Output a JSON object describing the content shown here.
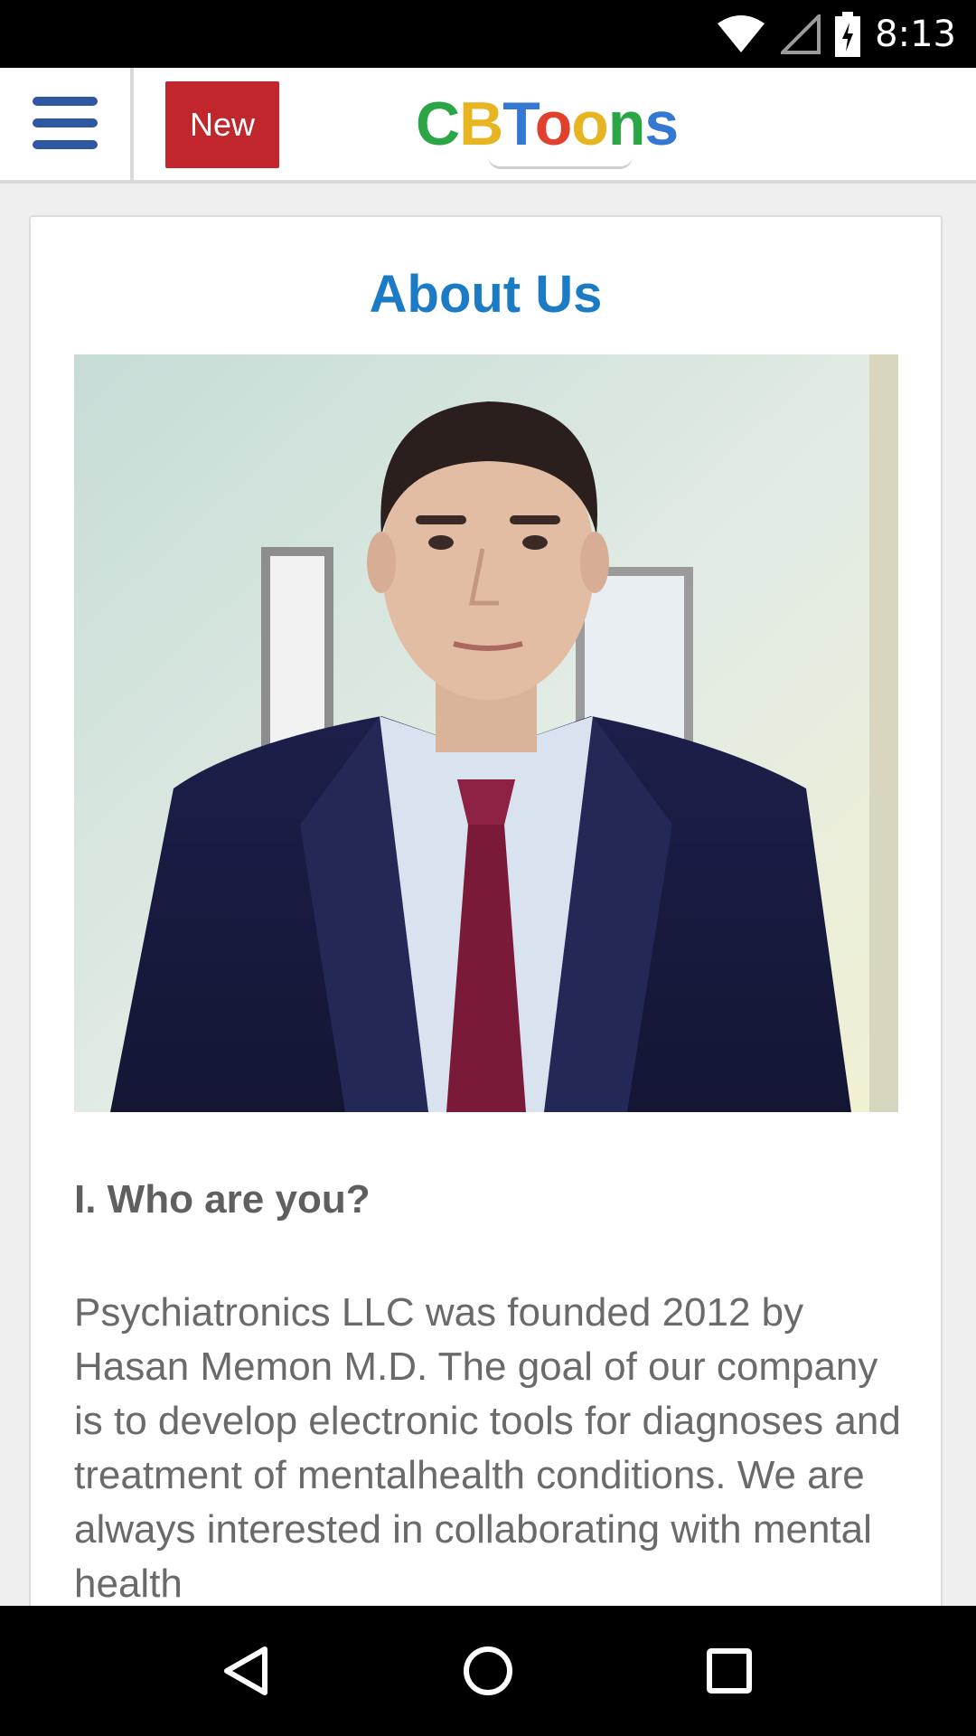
{
  "status_bar": {
    "time": "8:13",
    "icons": [
      "wifi-icon",
      "cell-signal-icon",
      "battery-charging-icon"
    ]
  },
  "app_bar": {
    "menu_icon": "hamburger-menu-icon",
    "new_button_label": "New",
    "logo_text": "CBToons",
    "colors": {
      "new_button_bg": "#c0262b",
      "menu_icon": "#2f58a4"
    }
  },
  "content": {
    "title": "About Us",
    "photo": "portrait-photo",
    "section_heading": "I. Who are you?",
    "body": "Psychiatronics LLC was founded 2012 by Hasan Memon M.D. The goal of our company is to develop electronic tools for diagnoses and treatment of mentalhealth conditions. We are always interested in collaborating with mental health"
  },
  "nav_bar": {
    "back_icon": "back-triangle-icon",
    "home_icon": "home-circle-icon",
    "recents_icon": "recents-square-icon"
  },
  "theme": {
    "title_color": "#1b7bc5",
    "text_color": "#6a6a6a"
  }
}
